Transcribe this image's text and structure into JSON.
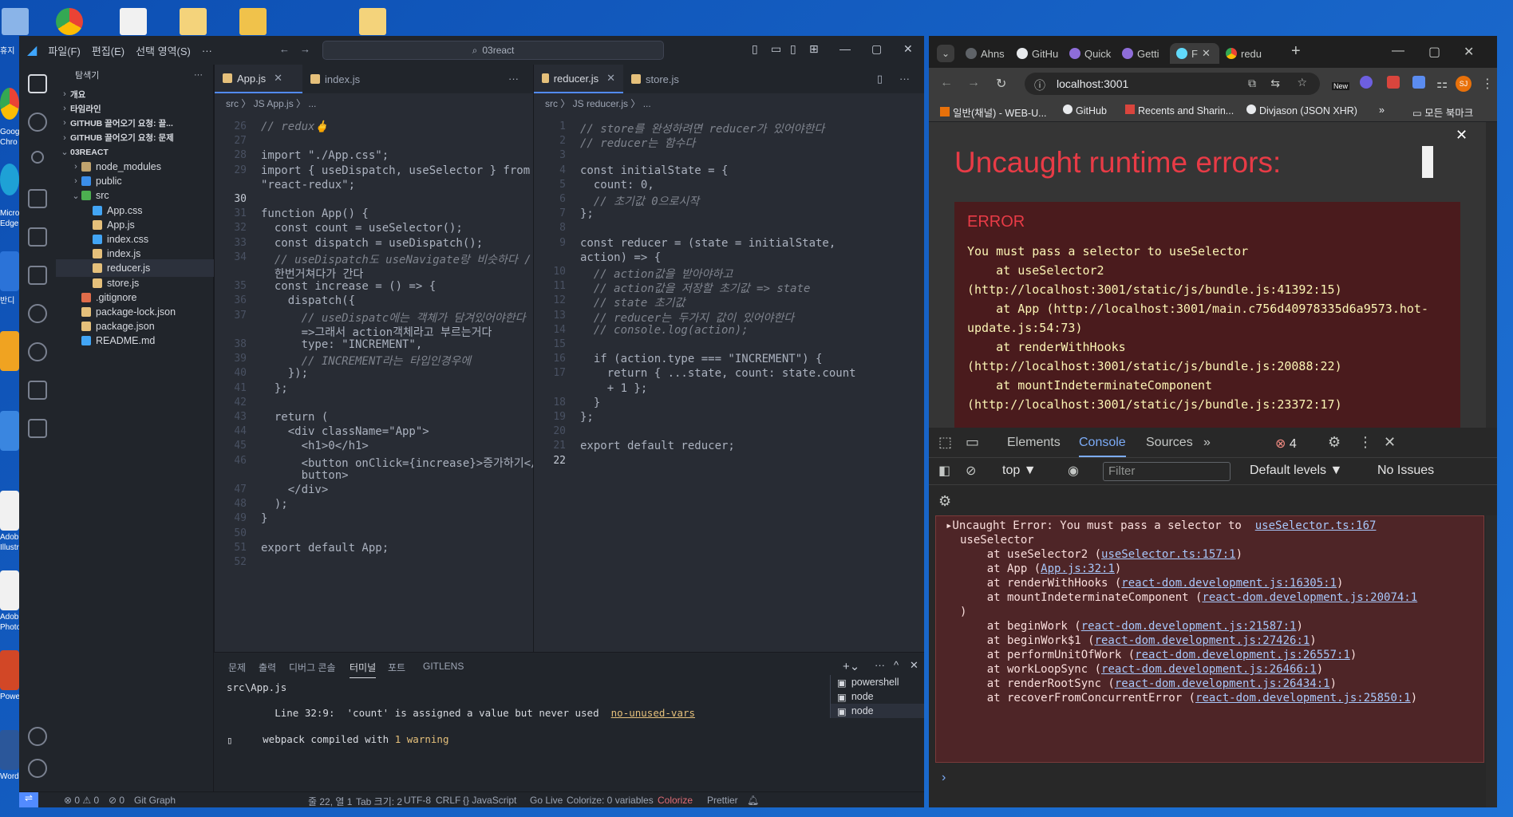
{
  "desktop": {
    "side_labels": [
      "휴지",
      "Goog",
      "Chro",
      "Micro",
      "Edge",
      "반디",
      "Adob",
      "Illustra",
      "Adob",
      "Photos",
      "PowerP",
      "Word"
    ]
  },
  "vscode": {
    "menus": [
      "파일(F)",
      "편집(E)",
      "선택 영역(S)",
      "···"
    ],
    "search": "03react",
    "explorer_title": "탐색기",
    "tree": [
      {
        "label": "개요",
        "indent": 0,
        "caret": "›",
        "icon": ""
      },
      {
        "label": "타임라인",
        "indent": 0,
        "caret": "›",
        "icon": ""
      },
      {
        "label": "GITHUB 끌어오기 요청: 끌...",
        "indent": 0,
        "caret": "›",
        "icon": ""
      },
      {
        "label": "GITHUB 끌어오기 요청: 문제",
        "indent": 0,
        "caret": "›",
        "icon": ""
      },
      {
        "label": "03REACT",
        "indent": 0,
        "caret": "⌄",
        "icon": ""
      },
      {
        "label": "node_modules",
        "indent": 1,
        "caret": "›",
        "icon": "folder"
      },
      {
        "label": "public",
        "indent": 1,
        "caret": "›",
        "icon": "folder-blue"
      },
      {
        "label": "src",
        "indent": 1,
        "caret": "⌄",
        "icon": "folder-green"
      },
      {
        "label": "App.css",
        "indent": 2,
        "caret": "",
        "icon": "css"
      },
      {
        "label": "App.js",
        "indent": 2,
        "caret": "",
        "icon": "js"
      },
      {
        "label": "index.css",
        "indent": 2,
        "caret": "",
        "icon": "css"
      },
      {
        "label": "index.js",
        "indent": 2,
        "caret": "",
        "icon": "js"
      },
      {
        "label": "reducer.js",
        "indent": 2,
        "caret": "",
        "icon": "js",
        "selected": true
      },
      {
        "label": "store.js",
        "indent": 2,
        "caret": "",
        "icon": "js"
      },
      {
        "label": ".gitignore",
        "indent": 1,
        "caret": "",
        "icon": "git"
      },
      {
        "label": "package-lock.json",
        "indent": 1,
        "caret": "",
        "icon": "json"
      },
      {
        "label": "package.json",
        "indent": 1,
        "caret": "",
        "icon": "json"
      },
      {
        "label": "README.md",
        "indent": 1,
        "caret": "",
        "icon": "info"
      }
    ],
    "left_tabs": [
      {
        "label": "App.js",
        "active": true
      },
      {
        "label": "index.js",
        "active": false
      }
    ],
    "left_crumb": "src 〉 JS App.js 〉 ...",
    "right_tabs": [
      {
        "label": "reducer.js",
        "active": true
      },
      {
        "label": "store.js",
        "active": false
      }
    ],
    "right_crumb": "src 〉 JS reducer.js 〉 ...",
    "left_code": [
      {
        "n": "26",
        "t": "// redux🖕"
      },
      {
        "n": "27",
        "t": ""
      },
      {
        "n": "28",
        "t": "import \"./App.css\";"
      },
      {
        "n": "29",
        "t": "import { useDispatch, useSelector } from"
      },
      {
        "n": "",
        "t": "\"react-redux\";"
      },
      {
        "n": "30",
        "t": ""
      },
      {
        "n": "31",
        "t": "function App() {"
      },
      {
        "n": "32",
        "t": "  const count = useSelector();"
      },
      {
        "n": "33",
        "t": "  const dispatch = useDispatch();"
      },
      {
        "n": "34",
        "t": "  // useDispatch도 useNavigate랑 비슷하다 /"
      },
      {
        "n": "",
        "t": "  한번거쳐다가 간다"
      },
      {
        "n": "35",
        "t": "  const increase = () => {"
      },
      {
        "n": "36",
        "t": "    dispatch({"
      },
      {
        "n": "37",
        "t": "      // useDispatc에는 객체가 담겨있어야한다"
      },
      {
        "n": "",
        "t": "      =>그래서 action객체라고 부르는거다"
      },
      {
        "n": "38",
        "t": "      type: \"INCREMENT\","
      },
      {
        "n": "39",
        "t": "      // INCREMENT라는 타입인경우에"
      },
      {
        "n": "40",
        "t": "    });"
      },
      {
        "n": "41",
        "t": "  };"
      },
      {
        "n": "42",
        "t": ""
      },
      {
        "n": "43",
        "t": "  return ("
      },
      {
        "n": "44",
        "t": "    <div className=\"App\">"
      },
      {
        "n": "45",
        "t": "      <h1>0</h1>"
      },
      {
        "n": "46",
        "t": "      <button onClick={increase}>증가하기</"
      },
      {
        "n": "",
        "t": "      button>"
      },
      {
        "n": "47",
        "t": "    </div>"
      },
      {
        "n": "48",
        "t": "  );"
      },
      {
        "n": "49",
        "t": "}"
      },
      {
        "n": "50",
        "t": ""
      },
      {
        "n": "51",
        "t": "export default App;"
      },
      {
        "n": "52",
        "t": ""
      }
    ],
    "right_code": [
      {
        "n": "1",
        "t": "// store를 완성하려면 reducer가 있어야한다"
      },
      {
        "n": "2",
        "t": "// reducer는 함수다"
      },
      {
        "n": "3",
        "t": ""
      },
      {
        "n": "4",
        "t": "const initialState = {"
      },
      {
        "n": "5",
        "t": "  count: 0,"
      },
      {
        "n": "6",
        "t": "  // 초기값 0으로시작"
      },
      {
        "n": "7",
        "t": "};"
      },
      {
        "n": "8",
        "t": ""
      },
      {
        "n": "9",
        "t": "const reducer = (state = initialState,"
      },
      {
        "n": "",
        "t": "action) => {"
      },
      {
        "n": "10",
        "t": "  // action값을 받아야하고"
      },
      {
        "n": "11",
        "t": "  // action값을 저장할 초기값 => state"
      },
      {
        "n": "12",
        "t": "  // state 초기값"
      },
      {
        "n": "13",
        "t": "  // reducer는 두가지 값이 있어야한다"
      },
      {
        "n": "14",
        "t": "  // console.log(action);"
      },
      {
        "n": "15",
        "t": ""
      },
      {
        "n": "16",
        "t": "  if (action.type === \"INCREMENT\") {"
      },
      {
        "n": "17",
        "t": "    return { ...state, count: state.count"
      },
      {
        "n": "",
        "t": "    + 1 };"
      },
      {
        "n": "18",
        "t": "  }"
      },
      {
        "n": "19",
        "t": "};"
      },
      {
        "n": "20",
        "t": ""
      },
      {
        "n": "21",
        "t": "export default reducer;"
      },
      {
        "n": "22",
        "t": ""
      }
    ],
    "panel_tabs": [
      "문제",
      "출력",
      "디버그 콘솔",
      "터미널",
      "포트",
      "GITLENS"
    ],
    "terminal": {
      "file": "src\\App.js",
      "warning_prefix": "  Line 32:9:  'count' is assigned a value but never used  ",
      "warning_rule": "no-unused-vars",
      "compiled_prefix": "webpack compiled with ",
      "compiled_count": "1 warning",
      "cursor": "▯"
    },
    "terminals": [
      "powershell",
      "node",
      "node"
    ],
    "status": {
      "errors": "⊗ 0 ⚠ 0",
      "ports": "⊘ 0",
      "git_graph": "Git Graph",
      "position": "줄 22, 열 1",
      "tab": "Tab 크기: 2",
      "encoding": "UTF-8",
      "eol": "CRLF",
      "lang": "{} JavaScript",
      "golive": "Go Live",
      "colorize_vars": "Colorize: 0 variables",
      "colorize": "Colorize",
      "prettier": "Prettier"
    }
  },
  "chrome": {
    "tabs": [
      "Ahns",
      "GitHu",
      "Quick",
      "Getti",
      "F",
      "redu"
    ],
    "url": "localhost:3001",
    "bookmarks": [
      "일반(채널) - WEB-U...",
      "GitHub",
      "Recents and Sharin...",
      "Divjason (JSON XHR)",
      "»",
      "모든 북마크"
    ],
    "new_badge": "New",
    "profile": "SJ",
    "overlay_title": "Uncaught runtime errors:",
    "error_label": "ERROR",
    "error_message": "You must pass a selector to useSelector\n    at useSelector2\n(http://localhost:3001/static/js/bundle.js:41392:15)\n    at App (http://localhost:3001/main.c756d40978335d6a9573.hot-\nupdate.js:54:73)\n    at renderWithHooks\n(http://localhost:3001/static/js/bundle.js:20088:22)\n    at mountIndeterminateComponent\n(http://localhost:3001/static/js/bundle.js:23372:17)",
    "devtools_tabs": [
      "Elements",
      "Console",
      "Sources",
      "»"
    ],
    "error_count": "4",
    "context": "top ▼",
    "filter_placeholder": "Filter",
    "levels": "Default levels ▼",
    "issues": "No Issues",
    "console_lines": [
      {
        "pre": "▸Uncaught Error: You must pass a selector to  ",
        "link": "useSelector.ts:167",
        "post": ""
      },
      {
        "pre": "useSelector",
        "link": "",
        "post": ""
      },
      {
        "pre": "    at useSelector2 (",
        "link": "useSelector.ts:157:1",
        "post": ")"
      },
      {
        "pre": "    at App (",
        "link": "App.js:32:1",
        "post": ")"
      },
      {
        "pre": "    at renderWithHooks (",
        "link": "react-dom.development.js:16305:1",
        "post": ")"
      },
      {
        "pre": "    at mountIndeterminateComponent (",
        "link": "react-dom.development.js:20074:1",
        "post": ""
      },
      {
        "pre": ")",
        "link": "",
        "post": ""
      },
      {
        "pre": "    at beginWork (",
        "link": "react-dom.development.js:21587:1",
        "post": ")"
      },
      {
        "pre": "    at beginWork$1 (",
        "link": "react-dom.development.js:27426:1",
        "post": ")"
      },
      {
        "pre": "    at performUnitOfWork (",
        "link": "react-dom.development.js:26557:1",
        "post": ")"
      },
      {
        "pre": "    at workLoopSync (",
        "link": "react-dom.development.js:26466:1",
        "post": ")"
      },
      {
        "pre": "    at renderRootSync (",
        "link": "react-dom.development.js:26434:1",
        "post": ")"
      },
      {
        "pre": "    at recoverFromConcurrentError (",
        "link": "react-dom.development.js:25850:1",
        "post": ")"
      }
    ],
    "prompt": "›"
  },
  "colors": {
    "accent": "#528bff",
    "error_red": "#e83b46",
    "console_link": "#a8c7fa"
  }
}
